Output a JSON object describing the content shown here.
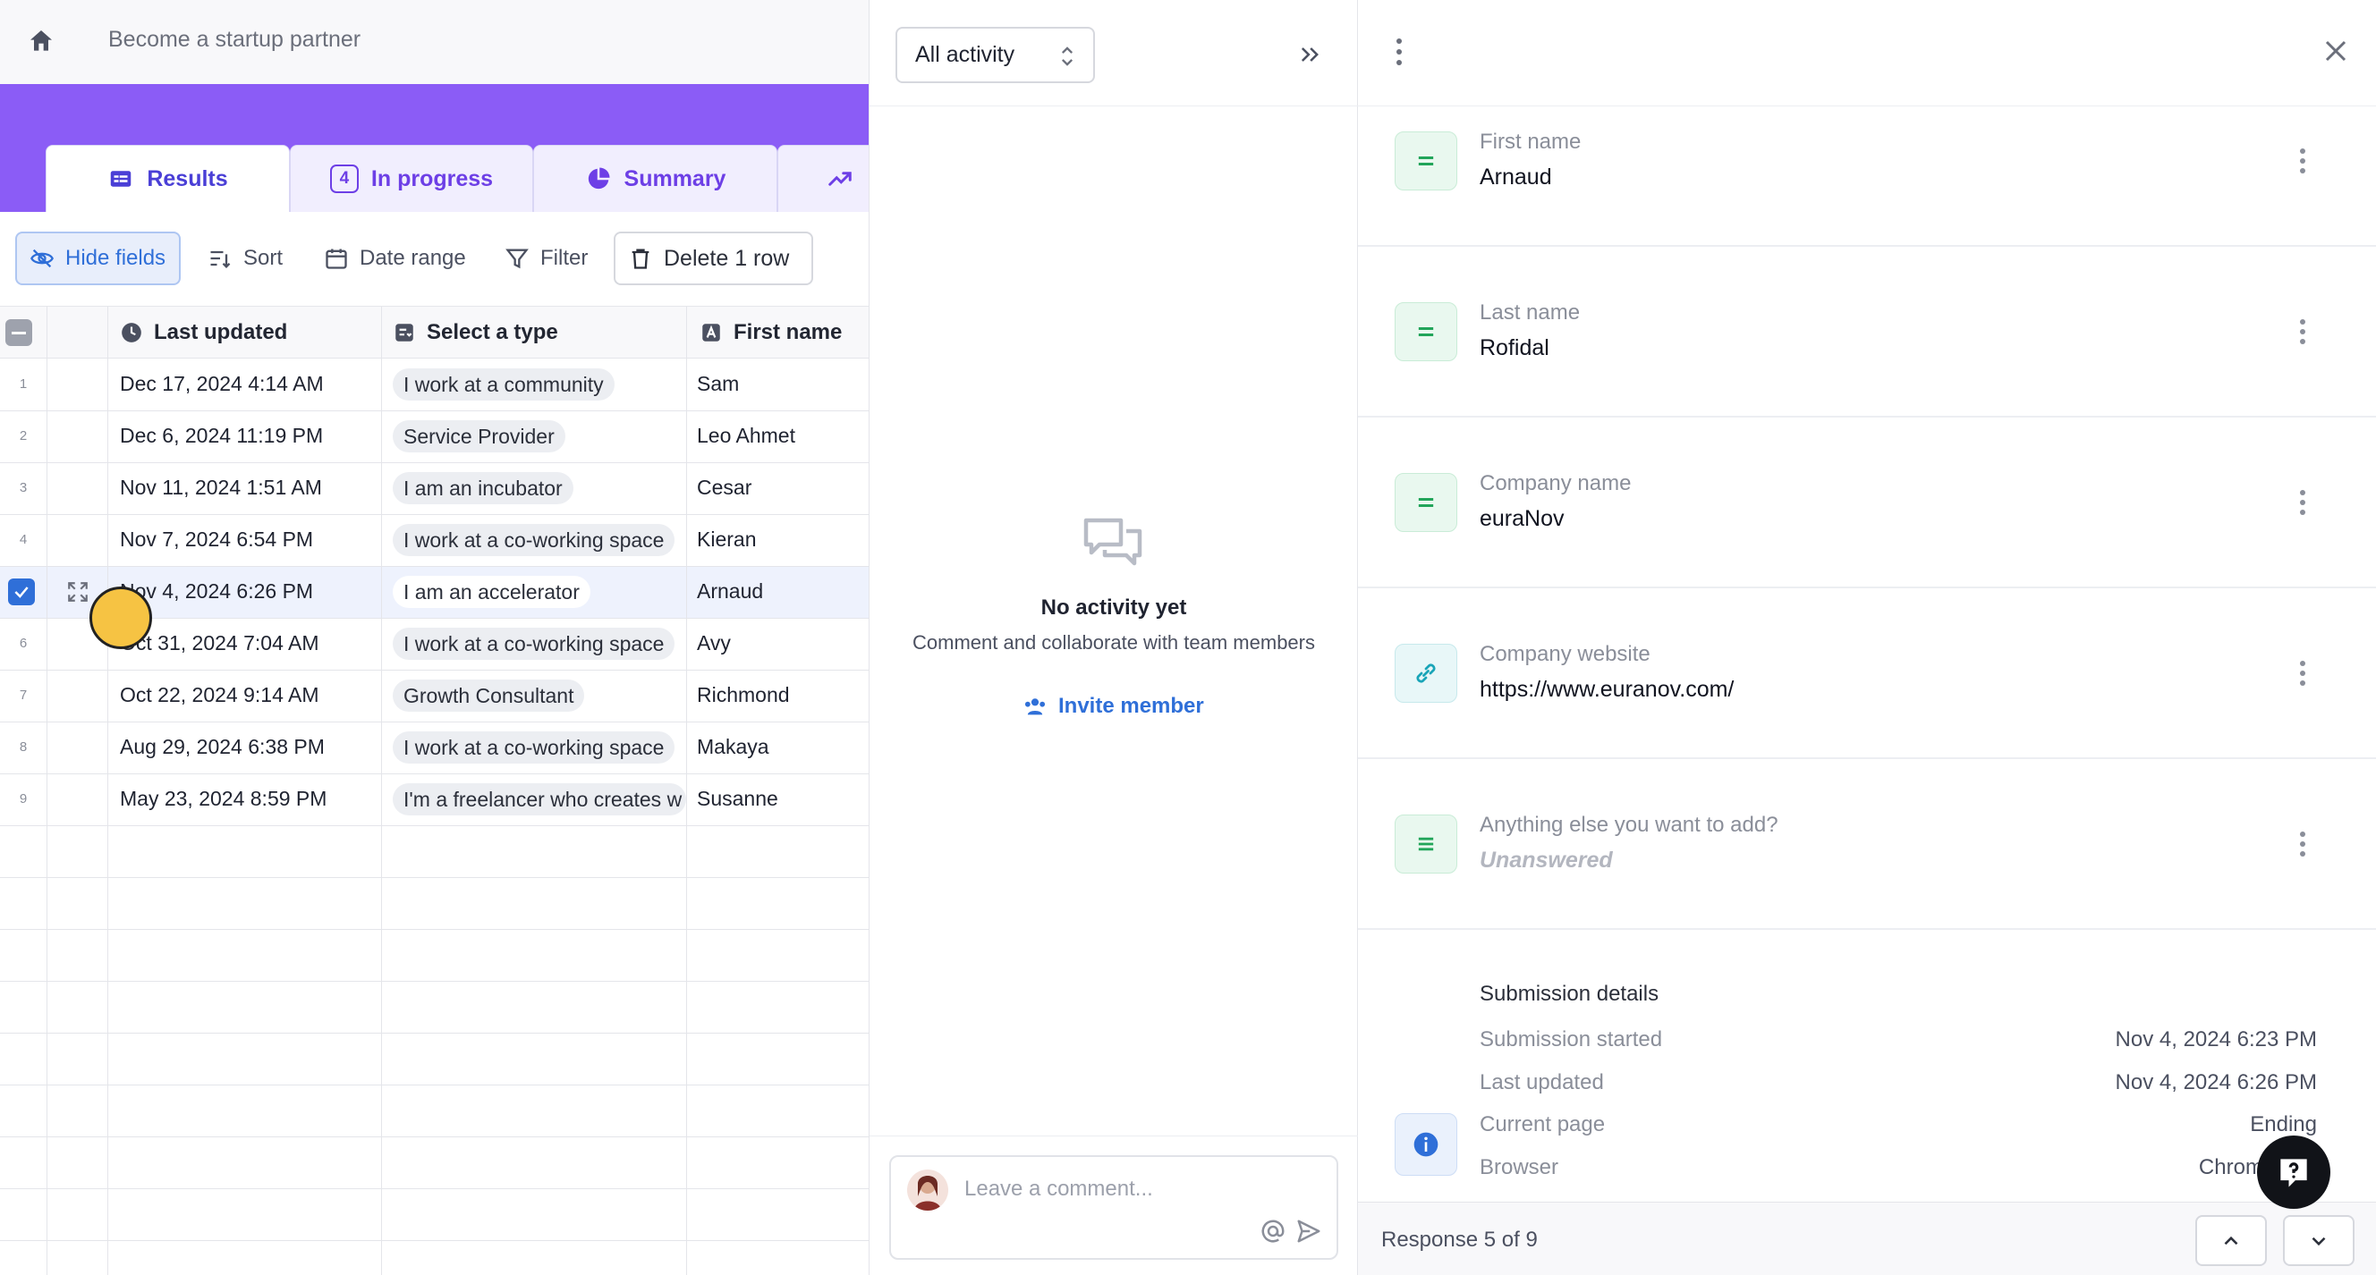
{
  "breadcrumb": "Become a startup partner",
  "tabs": [
    {
      "label": "Results",
      "icon": "table-icon",
      "active": true
    },
    {
      "label": "In progress",
      "badge": "4",
      "active": false
    },
    {
      "label": "Summary",
      "icon": "pie-chart-icon",
      "active": false
    },
    {
      "label": "",
      "icon": "trend-icon",
      "active": false
    }
  ],
  "toolbar": {
    "hide_fields": "Hide fields",
    "sort": "Sort",
    "date_range": "Date range",
    "filter": "Filter",
    "delete_row": "Delete 1 row"
  },
  "table": {
    "columns": [
      "Last updated",
      "Select a type",
      "First name"
    ],
    "rows": [
      {
        "num": "1",
        "date": "Dec 17, 2024 4:14 AM",
        "type": "I work at a community",
        "name": "Sam"
      },
      {
        "num": "2",
        "date": "Dec 6, 2024 11:19 PM",
        "type": "Service Provider",
        "name": "Leo Ahmet"
      },
      {
        "num": "3",
        "date": "Nov 11, 2024 1:51 AM",
        "type": "I am an incubator",
        "name": "Cesar"
      },
      {
        "num": "4",
        "date": "Nov 7, 2024 6:54 PM",
        "type": "I work at a co-working space",
        "name": "Kieran"
      },
      {
        "num": "",
        "date": "Nov 4, 2024 6:26 PM",
        "type": "I am an accelerator",
        "name": "Arnaud",
        "selected": true
      },
      {
        "num": "6",
        "date": "Oct 31, 2024 7:04 AM",
        "type": "I work at a co-working space",
        "name": "Avy"
      },
      {
        "num": "7",
        "date": "Oct 22, 2024 9:14 AM",
        "type": "Growth Consultant",
        "name": "Richmond"
      },
      {
        "num": "8",
        "date": "Aug 29, 2024 6:38 PM",
        "type": "I work at a co-working space",
        "name": "Makaya"
      },
      {
        "num": "9",
        "date": "May 23, 2024 8:59 PM",
        "type": "I'm a freelancer who creates w",
        "name": "Susanne"
      }
    ]
  },
  "activity": {
    "filter_value": "All activity",
    "empty_title": "No activity yet",
    "empty_subtitle": "Comment and collaborate with team members",
    "invite_label": "Invite member",
    "comment_placeholder": "Leave a comment..."
  },
  "response": {
    "fields": [
      {
        "label": "First name",
        "value": "Arnaud",
        "icon": "equals-icon"
      },
      {
        "label": "Last name",
        "value": "Rofidal",
        "icon": "equals-icon"
      },
      {
        "label": "Company name",
        "value": "euraNov",
        "icon": "equals-icon"
      },
      {
        "label": "Company website",
        "value": "https://www.euranov.com/",
        "icon": "link-icon"
      },
      {
        "label": "Anything else you want to add?",
        "value": "Unanswered",
        "icon": "equals-icon"
      }
    ],
    "details_title": "Submission details",
    "details": [
      {
        "label": "Submission started",
        "value": "Nov 4, 2024 6:23 PM"
      },
      {
        "label": "Last updated",
        "value": "Nov 4, 2024 6:26 PM"
      },
      {
        "label": "Current page",
        "value": "Ending"
      },
      {
        "label": "Browser",
        "value": "Chrome 130"
      }
    ],
    "counter": "Response 5 of 9"
  },
  "colors": {
    "banner": "#8b5cf6",
    "accent_blue": "#2f6fd8",
    "selected_row": "#eef2fd",
    "cursor": "#f6c343"
  }
}
